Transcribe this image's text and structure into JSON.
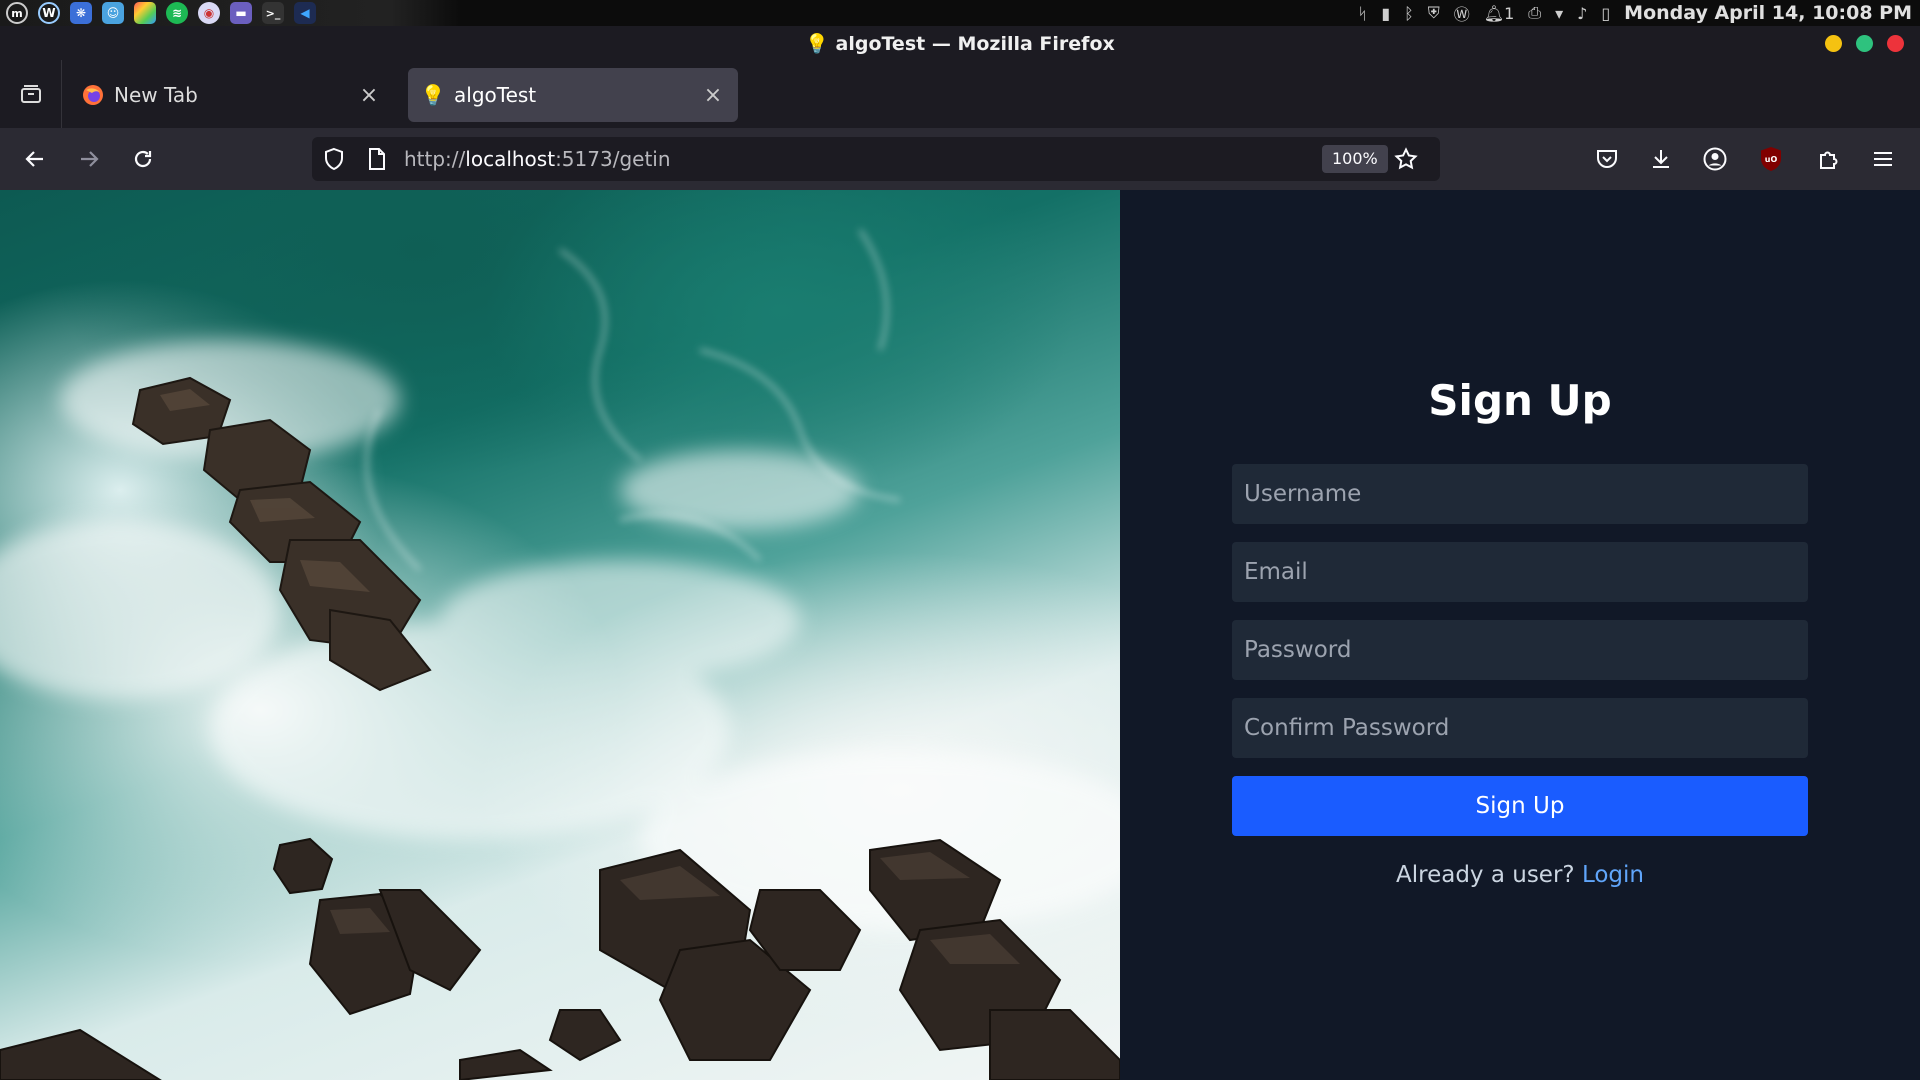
{
  "system_bar": {
    "clock": "Monday April 14, 10:08 PM",
    "notification_count": "1"
  },
  "window": {
    "title": "💡 algoTest — Mozilla Firefox"
  },
  "tabs": [
    {
      "label": "New Tab"
    },
    {
      "label": "algoTest"
    }
  ],
  "nav": {
    "url_prefix": "http://",
    "url_host": "localhost",
    "url_rest": ":5173/getin",
    "zoom": "100%"
  },
  "form": {
    "title": "Sign Up",
    "username_placeholder": "Username",
    "email_placeholder": "Email",
    "password_placeholder": "Password",
    "confirm_password_placeholder": "Confirm Password",
    "submit_label": "Sign Up",
    "already_text": "Already a user?",
    "login_label": "Login"
  },
  "colors": {
    "panel_bg": "#111827",
    "field_bg": "#1f2937",
    "button_bg": "#1a5cff",
    "link": "#60a5fa"
  }
}
